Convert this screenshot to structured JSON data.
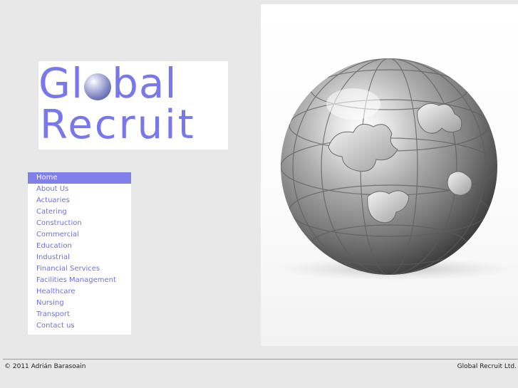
{
  "logo": {
    "line1_prefix": "Gl",
    "line1_suffix": "bal",
    "line2": "Recruit"
  },
  "nav": {
    "items": [
      {
        "label": "Home",
        "active": true
      },
      {
        "label": "About Us"
      },
      {
        "label": "Actuaries"
      },
      {
        "label": "Catering"
      },
      {
        "label": "Construction"
      },
      {
        "label": "Commercial"
      },
      {
        "label": "Education"
      },
      {
        "label": "Industrial"
      },
      {
        "label": "Financial Services"
      },
      {
        "label": "Facilities Management"
      },
      {
        "label": "Healthcare"
      },
      {
        "label": "Nursing"
      },
      {
        "label": "Transport"
      },
      {
        "label": "Contact us"
      }
    ]
  },
  "footer": {
    "copyright": "© 2011 Adrián Barasoain",
    "company": "Global Recruit Ltd."
  },
  "colors": {
    "brand": "#7777ee",
    "nav_active_bg": "#8080ea",
    "background": "#e8e8e8"
  },
  "photo": {
    "subject": "globe-puzzle-image"
  }
}
